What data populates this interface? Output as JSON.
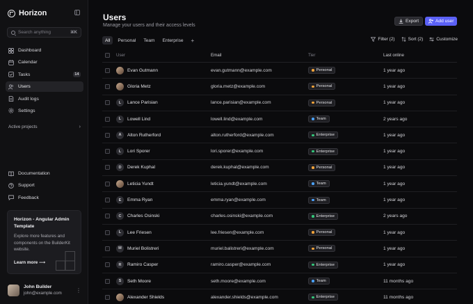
{
  "brand": {
    "name": "Horizon",
    "logo_icon": "horizon-logo-icon",
    "collapse_icon": "sidebar-toggle-icon"
  },
  "search": {
    "placeholder": "Search anything",
    "shortcut": "⌘K"
  },
  "nav": [
    {
      "key": "dashboard",
      "label": "Dashboard",
      "icon": "dashboard-icon",
      "active": false
    },
    {
      "key": "calendar",
      "label": "Calendar",
      "icon": "calendar-icon",
      "active": false
    },
    {
      "key": "tasks",
      "label": "Tasks",
      "icon": "tasks-icon",
      "badge": "14",
      "active": false
    },
    {
      "key": "users",
      "label": "Users",
      "icon": "users-icon",
      "active": true
    },
    {
      "key": "audit-logs",
      "label": "Audit logs",
      "icon": "audit-icon",
      "active": false
    },
    {
      "key": "settings",
      "label": "Settings",
      "icon": "gear-icon",
      "active": false
    }
  ],
  "projects": {
    "label": "Active projects"
  },
  "nav_bottom": [
    {
      "key": "documentation",
      "label": "Documentation",
      "icon": "book-icon"
    },
    {
      "key": "support",
      "label": "Support",
      "icon": "help-icon"
    },
    {
      "key": "feedback",
      "label": "Feedback",
      "icon": "feedback-icon"
    }
  ],
  "promo": {
    "title": "Horizon - Angular Admin Template",
    "text": "Explore more features and components on the BuilderKit website.",
    "link": "Learn more ⟶"
  },
  "user": {
    "name": "John Builder",
    "email": "john@example.com"
  },
  "page": {
    "title": "Users",
    "subtitle": "Manage your users and their access levels"
  },
  "actions": {
    "export": "Export",
    "add": "Add user"
  },
  "tabs": [
    {
      "label": "All",
      "active": true
    },
    {
      "label": "Personal",
      "active": false
    },
    {
      "label": "Team",
      "active": false
    },
    {
      "label": "Enterprise",
      "active": false
    }
  ],
  "toolbar": {
    "filter": "Filter (2)",
    "sort": "Sort (2)",
    "customize": "Customize"
  },
  "columns": {
    "user": "User",
    "email": "Email",
    "tier": "Tier",
    "online": "Last online"
  },
  "tier_colors": {
    "Personal": "#f2a33a",
    "Team": "#4aa3ff",
    "Enterprise": "#34c77b"
  },
  "rows": [
    {
      "name": "Evan Gutmann",
      "initial": "",
      "photo": true,
      "email": "evan.gutmann@example.com",
      "tier": "Personal",
      "online": "1 year ago"
    },
    {
      "name": "Gloria Metz",
      "initial": "",
      "photo": true,
      "email": "gloria.metz@example.com",
      "tier": "Personal",
      "online": "1 year ago"
    },
    {
      "name": "Lance Parisian",
      "initial": "L",
      "photo": false,
      "email": "lance.parisian@example.com",
      "tier": "Personal",
      "online": "1 year ago"
    },
    {
      "name": "Lowell Lind",
      "initial": "L",
      "photo": false,
      "email": "lowell.lind@example.com",
      "tier": "Team",
      "online": "2 years ago"
    },
    {
      "name": "Alton Rutherford",
      "initial": "A",
      "photo": false,
      "email": "alton.rutherford@example.com",
      "tier": "Enterprise",
      "online": "1 year ago"
    },
    {
      "name": "Lori Sporer",
      "initial": "L",
      "photo": false,
      "email": "lori.sporer@example.com",
      "tier": "Enterprise",
      "online": "1 year ago"
    },
    {
      "name": "Derek Kuphal",
      "initial": "D",
      "photo": false,
      "email": "derek.kuphal@example.com",
      "tier": "Personal",
      "online": "1 year ago"
    },
    {
      "name": "Leticia Yundt",
      "initial": "",
      "photo": true,
      "email": "leticia.yundt@example.com",
      "tier": "Team",
      "online": "1 year ago"
    },
    {
      "name": "Emma Ryan",
      "initial": "E",
      "photo": false,
      "email": "emma.ryan@example.com",
      "tier": "Team",
      "online": "1 year ago"
    },
    {
      "name": "Charles Osinski",
      "initial": "C",
      "photo": false,
      "email": "charles.osinski@example.com",
      "tier": "Enterprise",
      "online": "2 years ago"
    },
    {
      "name": "Lee Friesen",
      "initial": "L",
      "photo": false,
      "email": "lee.friesen@example.com",
      "tier": "Personal",
      "online": "1 year ago"
    },
    {
      "name": "Muriel Bolistreri",
      "initial": "M",
      "photo": false,
      "email": "muriel.balistreri@example.com",
      "tier": "Personal",
      "online": "1 year ago"
    },
    {
      "name": "Ramiro Casper",
      "initial": "R",
      "photo": false,
      "email": "ramiro.casper@example.com",
      "tier": "Enterprise",
      "online": "1 year ago"
    },
    {
      "name": "Seth Moore",
      "initial": "S",
      "photo": false,
      "email": "seth.moore@example.com",
      "tier": "Team",
      "online": "11 months ago"
    },
    {
      "name": "Alexander Shields",
      "initial": "",
      "photo": true,
      "email": "alexander.shields@example.com",
      "tier": "Enterprise",
      "online": "11 months ago"
    }
  ]
}
